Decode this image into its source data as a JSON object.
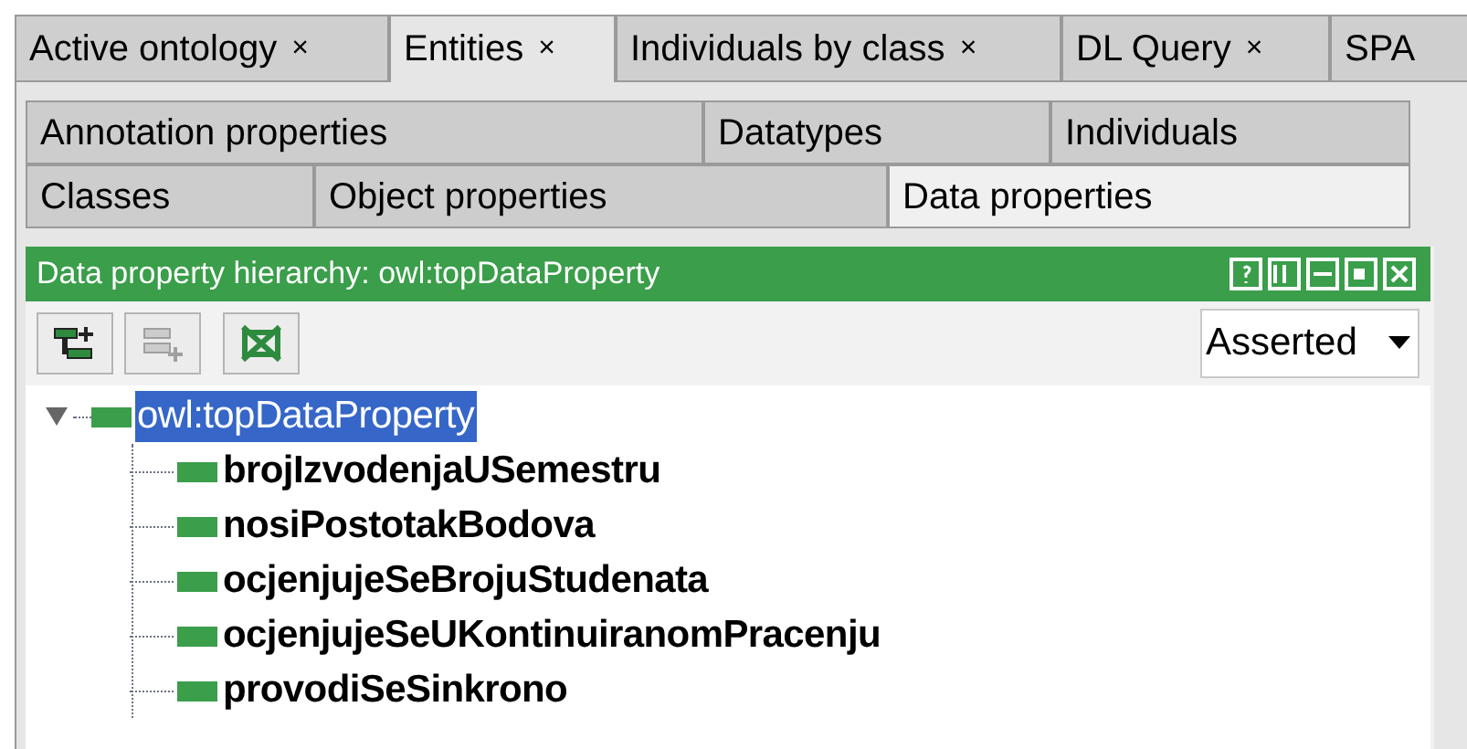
{
  "tabs": [
    {
      "label": "Active ontology",
      "close": "×",
      "selected": false
    },
    {
      "label": "Entities",
      "close": "×",
      "selected": true
    },
    {
      "label": "Individuals by class",
      "close": "×",
      "selected": false
    },
    {
      "label": "DL Query",
      "close": "×",
      "selected": false
    },
    {
      "label": "SPA",
      "selected": false
    }
  ],
  "entity_tabs": [
    [
      {
        "label": "Annotation properties",
        "selected": false
      },
      {
        "label": "Datatypes",
        "selected": false
      },
      {
        "label": "Individuals",
        "selected": false
      }
    ],
    [
      {
        "label": "Classes",
        "selected": false
      },
      {
        "label": "Object properties",
        "selected": false
      },
      {
        "label": "Data properties",
        "selected": true
      }
    ]
  ],
  "panel": {
    "title": "Data property hierarchy: owl:topDataProperty",
    "toolbar": [
      {
        "kind": "add-sub",
        "disabled": false
      },
      {
        "kind": "add-sibling",
        "disabled": true
      },
      {
        "kind": "delete",
        "disabled": false
      }
    ],
    "mode": "Asserted",
    "tree": [
      {
        "label": "owl:topDataProperty",
        "selected": true,
        "expanded": true,
        "bold": false,
        "children": [
          {
            "label": "brojIzvodenjaUSemestru",
            "selected": false,
            "bold": true
          },
          {
            "label": "nosiPostotakBodova",
            "selected": false,
            "bold": true
          },
          {
            "label": "ocjenjujeSeBrojuStudenata",
            "selected": false,
            "bold": true
          },
          {
            "label": "ocjenjujeSeUKontinuiranomPracenju",
            "selected": false,
            "bold": true
          },
          {
            "label": "provodiSeSinkrono",
            "selected": false,
            "bold": true
          }
        ]
      }
    ]
  }
}
